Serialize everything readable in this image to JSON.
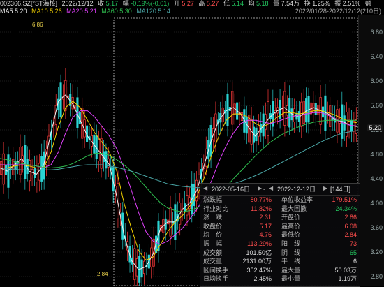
{
  "info": {
    "code": "002366.SZ[*ST海核]",
    "date": "2022/12/12",
    "close_label": "收",
    "close": "5.17",
    "change_label": "幅",
    "change": "-0.19%(-0.01)",
    "open_label": "开",
    "open": "5.27",
    "high_label": "高",
    "high": "5.27",
    "low_label": "低",
    "low": "5.14",
    "avg_label": "均",
    "avg": "5.18",
    "amount_label": "量",
    "amount": "7.54万",
    "turnover_label": "换",
    "turnover": "1.25%",
    "amplitude_label": "振",
    "amplitude": "2.51%",
    "tail_label": "额"
  },
  "ma": {
    "ma5_label": "MA5",
    "ma5": "5.20",
    "ma10_label": "MA10",
    "ma10": "5.26",
    "ma20_label": "MA20",
    "ma20": "5.21",
    "ma60_label": "MA60",
    "ma60": "5.30",
    "ma120_label": "MA120",
    "ma120": "5.14",
    "range_text": "2022/01/28-2022/12/12(210日)"
  },
  "axis": {
    "labels": [
      "6.80",
      "6.40",
      "6.00",
      "5.60",
      "5.20",
      "4.80",
      "4.40",
      "4.00",
      "3.60",
      "3.20",
      "2.80"
    ],
    "last": "5.20"
  },
  "markers": {
    "high": "6.86",
    "low": "2.84"
  },
  "colors": {
    "up": "#ff3b3b",
    "down": "#2bd4d4",
    "ma5": "#f2f2f2",
    "ma10": "#f0d000",
    "ma20": "#e040fb",
    "ma60": "#2fbf4f",
    "ma120": "#4aa7a7"
  },
  "panel": {
    "start": "2022-05-16日",
    "end": "2022-12-12日",
    "days": "[144日]",
    "rows": [
      {
        "l1": "涨跌幅",
        "v1": "80.77%",
        "c1": "red",
        "l2": "单位收益率",
        "v2": "179.51%",
        "c2": "red"
      },
      {
        "l1": "行业对比",
        "v1": "11.82%",
        "c1": "red",
        "l2": "最大回撤",
        "v2": "-24.34%",
        "c2": "green"
      },
      {
        "l1": "涨　跌",
        "v1": "2.31",
        "c1": "red",
        "l2": "开盘价",
        "v2": "2.86",
        "c2": "red"
      },
      {
        "l1": "收盘价",
        "v1": "5.17",
        "c1": "red",
        "l2": "最高价",
        "v2": "6.08",
        "c2": "red"
      },
      {
        "l1": "均　价",
        "v1": "4.76",
        "c1": "red",
        "l2": "最低价",
        "v2": "2.84",
        "c2": "red"
      },
      {
        "l1": "振　幅",
        "v1": "113.29%",
        "c1": "red",
        "l2": "阳　线",
        "v2": "73",
        "c2": "red"
      },
      {
        "l1": "成交额",
        "v1": "101.50亿",
        "c1": "white",
        "l2": "阴　线",
        "v2": "65",
        "c2": "green"
      },
      {
        "l1": "成交量",
        "v1": "2131.00万",
        "c1": "white",
        "l2": "平　线",
        "v2": "6",
        "c2": "white"
      },
      {
        "l1": "区间换手",
        "v1": "352.47%",
        "c1": "white",
        "l2": "最大量",
        "v2": "50.03万",
        "c2": "white"
      },
      {
        "l1": "日均换手",
        "v1": "2.45%",
        "c1": "white",
        "l2": "最小量",
        "v2": "1.19万",
        "c2": "white"
      }
    ]
  },
  "chart_data": {
    "type": "candlestick",
    "ylim": [
      2.7,
      6.95
    ],
    "ma": {
      "ma5": [
        4.55,
        4.5,
        4.6,
        4.7,
        4.5,
        4.45,
        4.6,
        5.1,
        5.6,
        5.7,
        5.55,
        5.3,
        5.05,
        4.9,
        4.75,
        4.6,
        4.1,
        3.5,
        3.1,
        2.95,
        3.0,
        3.2,
        3.6,
        3.7,
        3.7,
        3.9,
        4.0,
        4.2,
        4.6,
        5.0,
        5.3,
        5.45,
        5.5,
        5.4,
        5.2,
        5.05,
        5.2,
        5.35,
        5.45,
        5.5,
        5.4,
        5.35,
        5.45,
        5.5,
        5.45,
        5.4,
        5.3,
        5.28,
        5.22,
        5.2
      ],
      "ma10": [
        4.55,
        4.55,
        4.58,
        4.6,
        4.58,
        4.55,
        4.55,
        4.8,
        5.2,
        5.5,
        5.6,
        5.5,
        5.3,
        5.1,
        4.95,
        4.8,
        4.5,
        4.0,
        3.6,
        3.25,
        3.1,
        3.15,
        3.35,
        3.55,
        3.7,
        3.8,
        3.95,
        4.1,
        4.4,
        4.75,
        5.05,
        5.3,
        5.4,
        5.4,
        5.35,
        5.25,
        5.2,
        5.25,
        5.35,
        5.42,
        5.42,
        5.4,
        5.42,
        5.45,
        5.45,
        5.42,
        5.38,
        5.32,
        5.28,
        5.26
      ],
      "ma20": [
        4.6,
        4.6,
        4.6,
        4.6,
        4.6,
        4.58,
        4.55,
        4.6,
        4.8,
        5.1,
        5.35,
        5.45,
        5.45,
        5.35,
        5.2,
        5.05,
        4.85,
        4.55,
        4.2,
        3.85,
        3.55,
        3.4,
        3.35,
        3.4,
        3.5,
        3.6,
        3.75,
        3.9,
        4.1,
        4.35,
        4.65,
        4.9,
        5.1,
        5.25,
        5.3,
        5.3,
        5.28,
        5.25,
        5.28,
        5.32,
        5.36,
        5.38,
        5.4,
        5.42,
        5.42,
        5.38,
        5.32,
        5.26,
        5.22,
        5.21
      ],
      "ma60": [
        4.7,
        4.68,
        4.65,
        4.62,
        4.6,
        4.58,
        4.56,
        4.55,
        4.56,
        4.58,
        4.62,
        4.68,
        4.74,
        4.78,
        4.78,
        4.75,
        4.68,
        4.6,
        4.5,
        4.38,
        4.25,
        4.12,
        4.0,
        3.92,
        3.88,
        3.86,
        3.88,
        3.92,
        3.98,
        4.06,
        4.15,
        4.25,
        4.38,
        4.5,
        4.62,
        4.74,
        4.85,
        4.95,
        5.03,
        5.1,
        5.15,
        5.2,
        5.24,
        5.27,
        5.29,
        5.3,
        5.3,
        5.3,
        5.3,
        5.3
      ],
      "ma120": [
        4.55,
        4.54,
        4.53,
        4.52,
        4.52,
        4.52,
        4.52,
        4.52,
        4.53,
        4.55,
        4.57,
        4.59,
        4.6,
        4.6,
        4.6,
        4.58,
        4.56,
        4.53,
        4.5,
        4.46,
        4.42,
        4.38,
        4.34,
        4.3,
        4.28,
        4.26,
        4.25,
        4.24,
        4.24,
        4.24,
        4.25,
        4.27,
        4.3,
        4.34,
        4.38,
        4.43,
        4.48,
        4.54,
        4.6,
        4.66,
        4.72,
        4.78,
        4.84,
        4.9,
        4.96,
        5.01,
        5.06,
        5.1,
        5.12,
        5.14
      ]
    }
  }
}
